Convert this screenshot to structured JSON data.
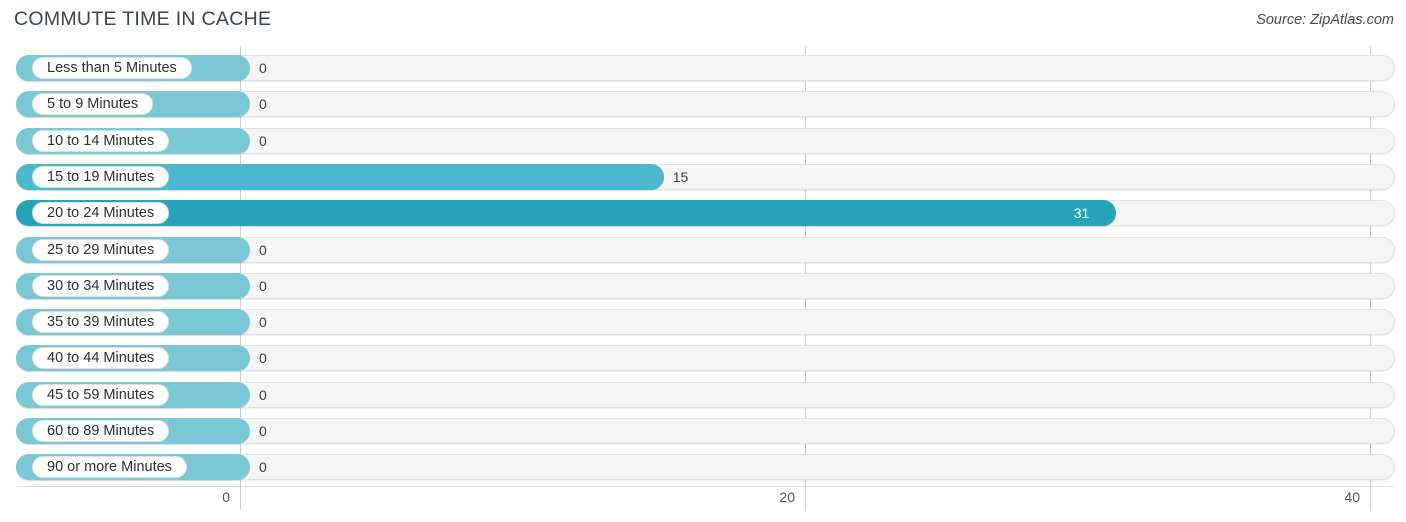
{
  "header": {
    "title": "COMMUTE TIME IN CACHE",
    "source": "Source: ZipAtlas.com"
  },
  "colors": {
    "bar_light": "#7ac8d5",
    "bar_mid": "#4bb8cd",
    "bar_dark": "#27a3b9",
    "track": "#f5f5f5",
    "track_border": "#e3e3e3",
    "gridline": "#cfcfcf",
    "title": "#3a4551",
    "value_text": "#3a3a44",
    "value_text_inside": "#ffffff"
  },
  "chart_data": {
    "type": "bar",
    "orientation": "horizontal",
    "title": "COMMUTE TIME IN CACHE",
    "xlabel": "",
    "ylabel": "",
    "xlim": [
      0,
      40
    ],
    "xticks": [
      0,
      20,
      40
    ],
    "xtick_labels": [
      "0",
      "20",
      "40"
    ],
    "grid": true,
    "legend": false,
    "categories": [
      "Less than 5 Minutes",
      "5 to 9 Minutes",
      "10 to 14 Minutes",
      "15 to 19 Minutes",
      "20 to 24 Minutes",
      "25 to 29 Minutes",
      "30 to 34 Minutes",
      "35 to 39 Minutes",
      "40 to 44 Minutes",
      "45 to 59 Minutes",
      "60 to 89 Minutes",
      "90 or more Minutes"
    ],
    "values": [
      0,
      0,
      0,
      15,
      31,
      0,
      0,
      0,
      0,
      0,
      0,
      0
    ],
    "value_labels": [
      "0",
      "0",
      "0",
      "15",
      "31",
      "0",
      "0",
      "0",
      "0",
      "0",
      "0",
      "0"
    ]
  },
  "axis": {
    "ticks": [
      {
        "label": "0",
        "value": 0
      },
      {
        "label": "20",
        "value": 20
      },
      {
        "label": "40",
        "value": 40
      }
    ]
  }
}
